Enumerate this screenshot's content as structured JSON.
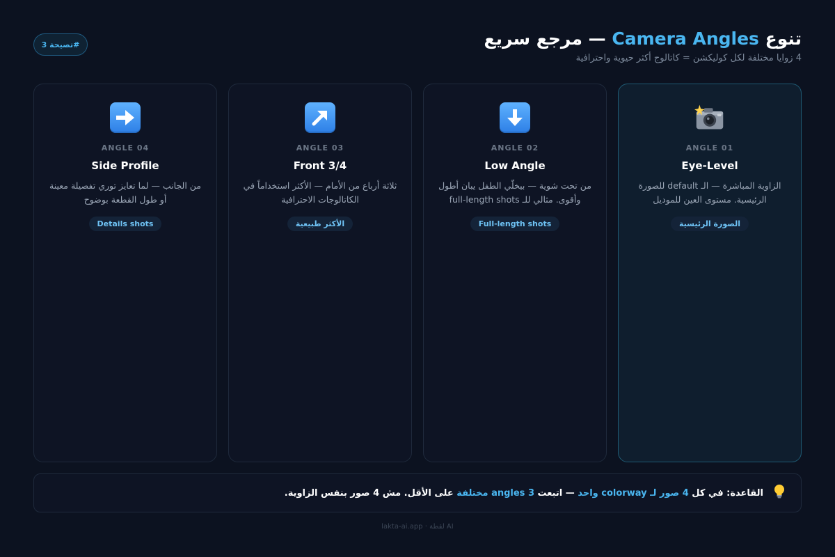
{
  "badge": "تصيحة 3#",
  "header": {
    "title_main": "تنوع",
    "title_accent": "Camera Angles",
    "title_rest": "— مرجع سريع",
    "subtitle": "4 زوايا مختلفة لكل كوليكشن = كاتالوج أكثر حيوية واحترافية"
  },
  "cards": [
    {
      "icon": "camera-flash-icon",
      "angle": "ANGLE 01",
      "title": "Eye-Level",
      "desc": "الزاوية المباشرة — الـ default للصورة الرئيسية. مستوى العين للموديل",
      "tag": "الصورة الرئيسية"
    },
    {
      "icon": "down-arrow-icon",
      "angle": "ANGLE 02",
      "title": "Low Angle",
      "desc": "من تحت شوية — بيخلّي الطفل يبان أطول وأقوى. مثالي للـ full-length shots",
      "tag": "Full-length shots"
    },
    {
      "icon": "up-right-arrow-icon",
      "angle": "ANGLE 03",
      "title": "Front 3/4",
      "desc": "ثلاثة أرباع من الأمام — الأكثر استخداماً في الكاتالوجات الاحترافية",
      "tag": "الأكثر طبيعية"
    },
    {
      "icon": "right-arrow-icon",
      "angle": "ANGLE 04",
      "title": "Side Profile",
      "desc": "من الجانب — لما تعايز توري تفصيلة معينة أو طول القطعة بوضوح",
      "tag": "Details shots"
    }
  ],
  "rule": {
    "icon": "lightbulb-icon",
    "p1": "القاعدة: في كل",
    "h1": "4 صور",
    "p2": "لـ",
    "h2": "colorway واحد",
    "p3": "— اتبعت",
    "h3": "3 angles مختلفة",
    "p4": "على الأقل. مش 4 صور بنفس الزاوية."
  },
  "footer": "lakta-ai.app · لقطة AI",
  "colors": {
    "background": "#0c1220",
    "card": "#0e1424",
    "accent": "#4ab6f0",
    "active_border": "#1f5a73"
  }
}
